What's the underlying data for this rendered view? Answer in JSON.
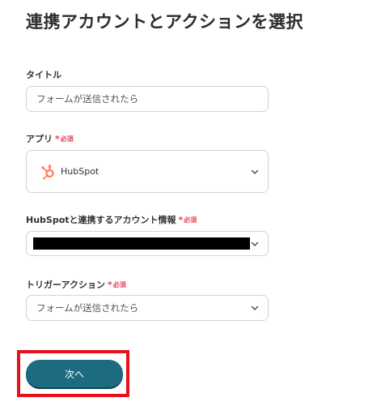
{
  "header": {
    "title": "連携アカウントとアクションを選択"
  },
  "form": {
    "title_field": {
      "label": "タイトル",
      "value": "フォームが送信されたら"
    },
    "app_field": {
      "label": "アプリ",
      "required_star": "*",
      "required_text": "必須",
      "selected_app": "HubSpot",
      "app_icon": "hubspot-logo-icon"
    },
    "account_field": {
      "label": "HubSpotと連携するアカウント情報",
      "required_star": "*",
      "required_text": "必須",
      "value_redacted": true
    },
    "trigger_field": {
      "label": "トリガーアクション",
      "required_star": "*",
      "required_text": "必須",
      "selected": "フォームが送信されたら"
    }
  },
  "actions": {
    "next_label": "次へ"
  },
  "colors": {
    "primary": "#1d6b80",
    "required": "#e0435a",
    "highlight": "#e8101a",
    "hubspot": "#ff7a59"
  }
}
